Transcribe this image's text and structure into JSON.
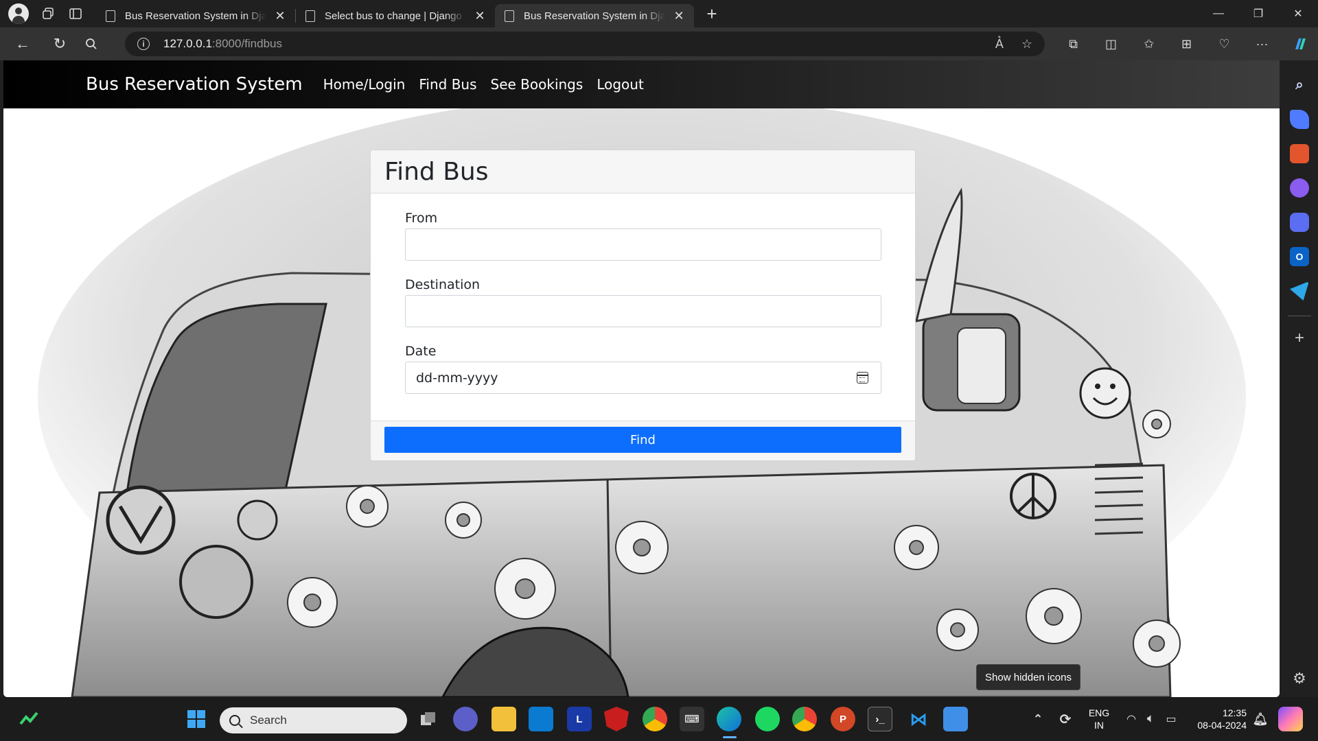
{
  "browser": {
    "tabs": [
      {
        "title": "Bus Reservation System in Django",
        "active": false
      },
      {
        "title": "Select bus to change | Django site admin",
        "active": false
      },
      {
        "title": "Bus Reservation System in Django",
        "active": true
      }
    ],
    "url_host": "127.0.0.1",
    "url_path": ":8000/findbus"
  },
  "navbar": {
    "brand": "Bus Reservation System",
    "links": [
      "Home/Login",
      "Find Bus",
      "See Bookings",
      "Logout"
    ]
  },
  "form": {
    "title": "Find Bus",
    "from_label": "From",
    "from_value": "",
    "destination_label": "Destination",
    "destination_value": "",
    "date_label": "Date",
    "date_placeholder": "dd-mm-yyyy",
    "submit_label": "Find"
  },
  "tooltip": "Show hidden icons",
  "taskbar": {
    "search_placeholder": "Search",
    "lang_line1": "ENG",
    "lang_line2": "IN",
    "time": "12:35",
    "date": "08-04-2024"
  },
  "colors": {
    "primary_button": "#0d6efd",
    "navbar_start": "#000000",
    "navbar_end": "#3d3d3d"
  }
}
